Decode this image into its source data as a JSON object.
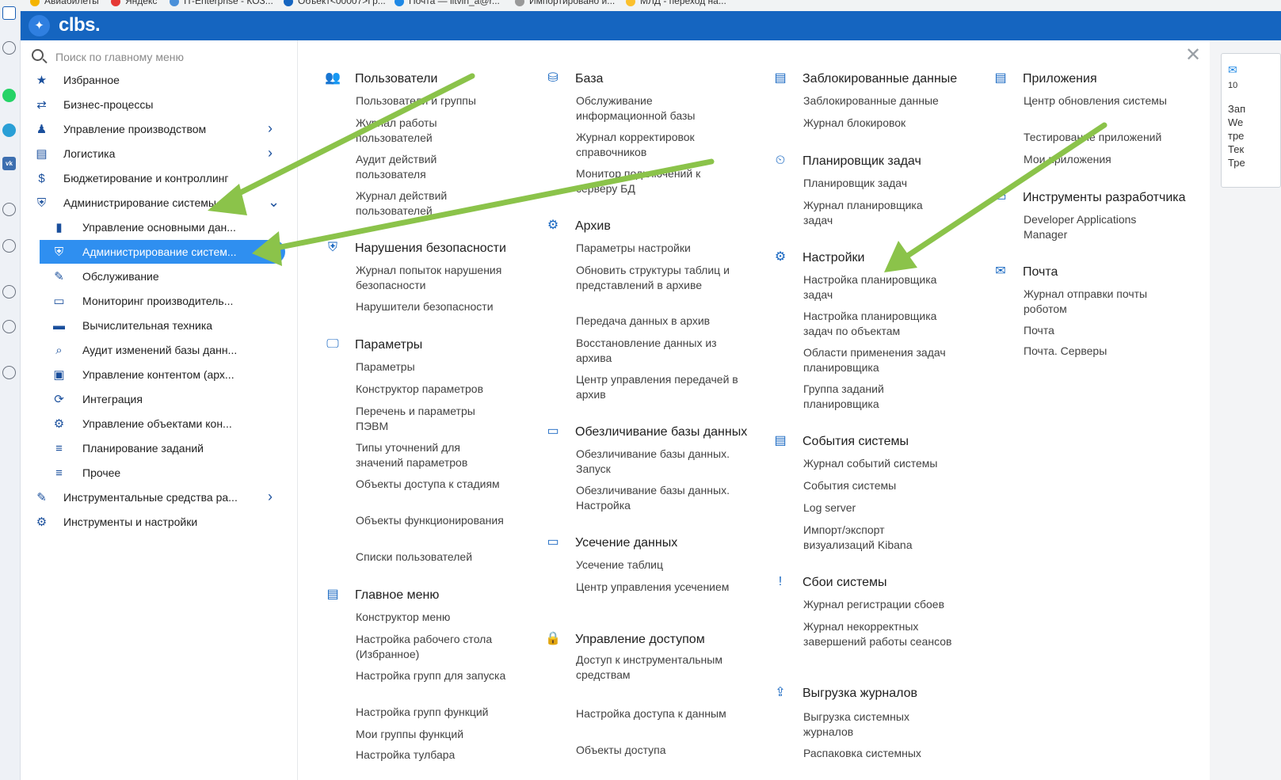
{
  "browser_bookmarks": [
    "Авиабилеты",
    "Яндекс",
    "IT-Enterprise - КОЗ...",
    "Объект<00007>Гр...",
    "Почта — litvin_a@r...",
    "Импортировано и...",
    "МЛД - переход на..."
  ],
  "app": {
    "logo_text": "clbs."
  },
  "search": {
    "placeholder": "Поиск по главному меню"
  },
  "sidebar": {
    "items": [
      {
        "label": "Избранное",
        "icon": "star-icon"
      },
      {
        "label": "Бизнес-процессы",
        "icon": "process-icon"
      },
      {
        "label": "Управление производством",
        "icon": "factory-icon"
      },
      {
        "label": "Логистика",
        "icon": "document-icon"
      },
      {
        "label": "Бюджетирование и контроллинг",
        "icon": "budget-icon"
      },
      {
        "label": "Администрирование системы",
        "icon": "shield-icon"
      },
      {
        "label": "Управление основными дан...",
        "icon": "book-icon"
      },
      {
        "label": "Администрирование систем...",
        "icon": "shield-icon"
      },
      {
        "label": "Обслуживание",
        "icon": "wrench-icon"
      },
      {
        "label": "Мониторинг производитель...",
        "icon": "monitor-icon"
      },
      {
        "label": "Вычислительная техника",
        "icon": "laptop-icon"
      },
      {
        "label": "Аудит изменений базы данн...",
        "icon": "audit-icon"
      },
      {
        "label": "Управление контентом (арх...",
        "icon": "archive-icon"
      },
      {
        "label": "Интеграция",
        "icon": "sync-icon"
      },
      {
        "label": "Управление объектами кон...",
        "icon": "gears-icon"
      },
      {
        "label": "Планирование заданий",
        "icon": "list-icon"
      },
      {
        "label": "Прочее",
        "icon": "list-icon"
      },
      {
        "label": "Инструментальные средства ра...",
        "icon": "wrench-icon"
      },
      {
        "label": "Инструменты и настройки",
        "icon": "gear-icon"
      }
    ]
  },
  "menu": {
    "col1": [
      {
        "title": "Пользователи",
        "links": [
          "Пользователи и группы",
          "Журнал работы пользователей",
          "Аудит действий пользователя",
          "Журнал действий пользователей"
        ]
      },
      {
        "title": "Нарушения безопасности",
        "links": [
          "Журнал попыток нарушения безопасности",
          "Нарушители безопасности"
        ]
      },
      {
        "title": "Параметры",
        "links": [
          "Параметры",
          "Конструктор параметров",
          "Перечень и параметры ПЭВМ",
          "Типы уточнений для значений параметров",
          "Объекты доступа к стадиям",
          "Объекты функционирования",
          "Списки пользователей"
        ]
      },
      {
        "title": "Главное меню",
        "links": [
          "Конструктор меню",
          "Настройка рабочего стола (Избранное)",
          "Настройка групп для запуска",
          "Настройка групп функций",
          "Мои группы функций",
          "Настройка тулбара"
        ]
      }
    ],
    "col2": [
      {
        "title": "База",
        "links": [
          "Обслуживание информационной базы",
          "Журнал корректировок справочников",
          "Монитор подключений к серверу БД"
        ]
      },
      {
        "title": "Архив",
        "links": [
          "Параметры настройки",
          "Обновить структуры таблиц и представлений в архиве",
          "Передача данных в архив",
          "Восстановление данных из архива",
          "Центр управления передачей в архив"
        ]
      },
      {
        "title": "Обезличивание базы данных",
        "links": [
          "Обезличивание базы данных. Запуск",
          "Обезличивание базы данных. Настройка"
        ]
      },
      {
        "title": "Усечение данных",
        "links": [
          "Усечение таблиц",
          "Центр управления усечением"
        ]
      },
      {
        "title": "Управление доступом",
        "links": [
          "Доступ к инструментальным средствам",
          "Настройка доступа к данным",
          "Объекты доступа"
        ]
      }
    ],
    "col3": [
      {
        "title": "Заблокированные данные",
        "links": [
          "Заблокированные данные",
          "Журнал блокировок"
        ]
      },
      {
        "title": "Планировщик задач",
        "links": [
          "Планировщик задач",
          "Журнал планировщика задач"
        ]
      },
      {
        "title": "Настройки",
        "links": [
          "Настройка планировщика задач",
          "Настройка планировщика задач по объектам",
          "Области применения задач планировщика",
          "Группа заданий планировщика"
        ]
      },
      {
        "title": "События системы",
        "links": [
          "Журнал событий системы",
          "События системы",
          "Log server",
          "Импорт/экспорт визуализаций Kibana"
        ]
      },
      {
        "title": "Сбои системы",
        "links": [
          "Журнал регистрации сбоев",
          "Журнал некорректных завершений работы сеансов"
        ]
      },
      {
        "title": "Выгрузка журналов",
        "links": [
          "Выгрузка системных журналов",
          "Распаковка системных"
        ]
      }
    ],
    "col4": [
      {
        "title": "Приложения",
        "links": [
          "Центр обновления системы",
          "Тестирование приложений",
          "Мои приложения"
        ]
      },
      {
        "title": "Инструменты разработчика",
        "links": [
          "Developer Applications Manager"
        ]
      },
      {
        "title": "Почта",
        "links": [
          "Журнал отправки почты роботом",
          "Почта",
          "Почта. Серверы"
        ]
      }
    ]
  },
  "right_panel": {
    "lines": [
      "10",
      "Зап",
      "We",
      "тре",
      "Тек",
      "Тре"
    ]
  },
  "colors": {
    "topbar": "#1565c0",
    "accent": "#2f8ff0",
    "arrow": "#8bc34a"
  }
}
